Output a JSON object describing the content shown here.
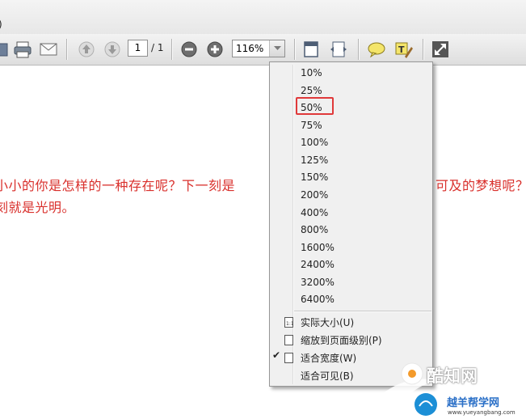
{
  "menubar": {
    "fragment": ")"
  },
  "toolbar": {
    "page_current": "1",
    "page_total": "/ 1",
    "zoom_value": "116%"
  },
  "document": {
    "line1_left": "小小的你是怎样的一种存在呢？下一刻是",
    "line1_right": "可及的梦想呢？",
    "line2": "刻就是光明。"
  },
  "zoom_menu": {
    "levels": [
      "10%",
      "25%",
      "50%",
      "75%",
      "100%",
      "125%",
      "150%",
      "200%",
      "400%",
      "800%",
      "1600%",
      "2400%",
      "3200%",
      "6400%"
    ],
    "highlighted": "50%",
    "fit_options": [
      {
        "label": "实际大小(U)",
        "checked": false
      },
      {
        "label": "缩放到页面级别(P)",
        "checked": false
      },
      {
        "label": "适合宽度(W)",
        "checked": true
      },
      {
        "label": "适合可见(B)",
        "checked": false
      }
    ]
  },
  "watermark": {
    "brand": "酷知网",
    "sub": "越羊帮学网",
    "url": "www.yueyangbang.com"
  },
  "colors": {
    "doc_text": "#d9302c",
    "highlight": "#e0393a",
    "menu_bg": "#f0f0f0"
  }
}
